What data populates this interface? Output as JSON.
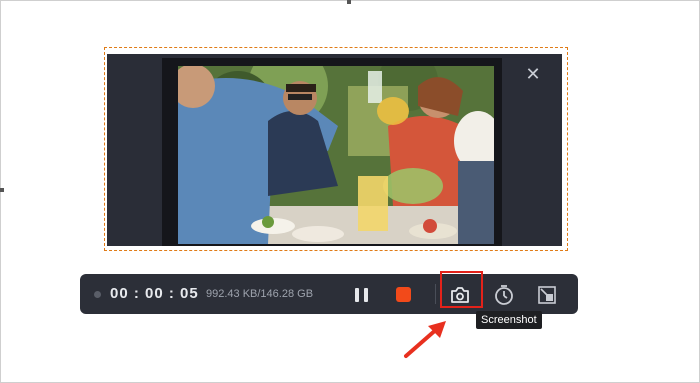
{
  "recorder": {
    "timer": "00 : 00 : 05",
    "file_size": "992.43 KB/146.28 GB",
    "tooltip": "Screenshot"
  },
  "toolbar_buttons": {
    "pause": "pause-icon",
    "stop": "stop-icon",
    "screenshot": "camera-icon",
    "schedule": "timer-icon",
    "minimize": "minimize-icon"
  },
  "colors": {
    "region_border": "#e07b16",
    "stop": "#f24a1a",
    "highlight": "#e3221a",
    "toolbar_bg": "#2c2f38"
  }
}
